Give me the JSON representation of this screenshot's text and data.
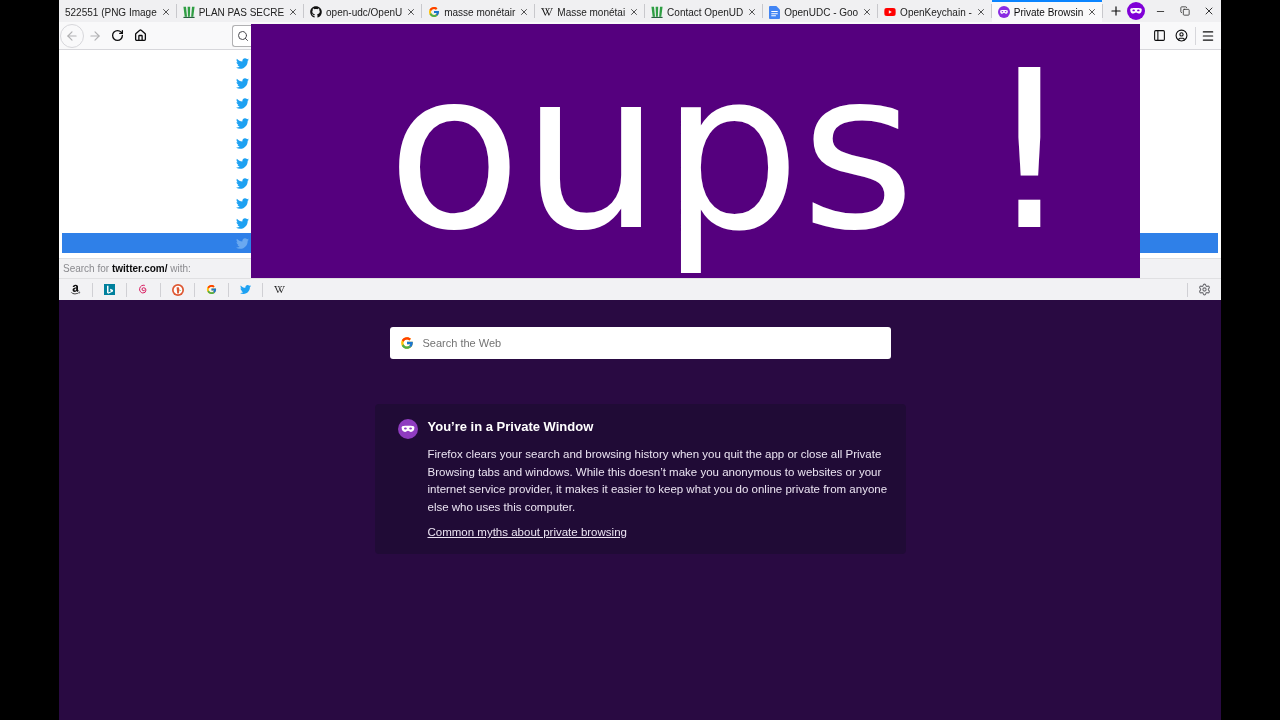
{
  "tabs": [
    {
      "title": "522551 (PNG Image",
      "selected": false
    },
    {
      "title": "PLAN PAS SECRE",
      "selected": false
    },
    {
      "title": "open-udc/OpenU",
      "selected": false
    },
    {
      "title": "masse monétair",
      "selected": false
    },
    {
      "title": "Masse monétai",
      "selected": false
    },
    {
      "title": "Contact OpenUD",
      "selected": false
    },
    {
      "title": "OpenUDC - Goo",
      "selected": false
    },
    {
      "title": "OpenKeychain -",
      "selected": false
    },
    {
      "title": "Private Browsin",
      "selected": true
    }
  ],
  "toolbar": {
    "buttons": [
      {
        "kind": "back",
        "disabled": true
      },
      {
        "kind": "forward",
        "disabled": true
      },
      {
        "kind": "reload",
        "disabled": false
      },
      {
        "kind": "home",
        "disabled": false
      }
    ]
  },
  "url_suggestions": [
    {
      "selected": false
    },
    {
      "selected": false
    },
    {
      "selected": false
    },
    {
      "selected": false
    },
    {
      "selected": false
    },
    {
      "selected": false
    },
    {
      "selected": false
    },
    {
      "selected": false
    },
    {
      "selected": false
    },
    {
      "selected": true
    }
  ],
  "search_with": "Search for **twitter.com/** with:",
  "page": {
    "search": {
      "placeholder": "Search the Web"
    },
    "private_notice": {
      "title": "You’re in a Private Window",
      "body": "Firefox clears your search and browsing history when you quit the app or close all Private Browsing tabs and windows. While this doesn’t make you anonymous to websites or your internet service provider, it makes it easier to keep what you do online private from anyone else who uses this computer.",
      "link": "Common myths about private browsing"
    }
  },
  "overlay": {
    "text": "oups !"
  }
}
